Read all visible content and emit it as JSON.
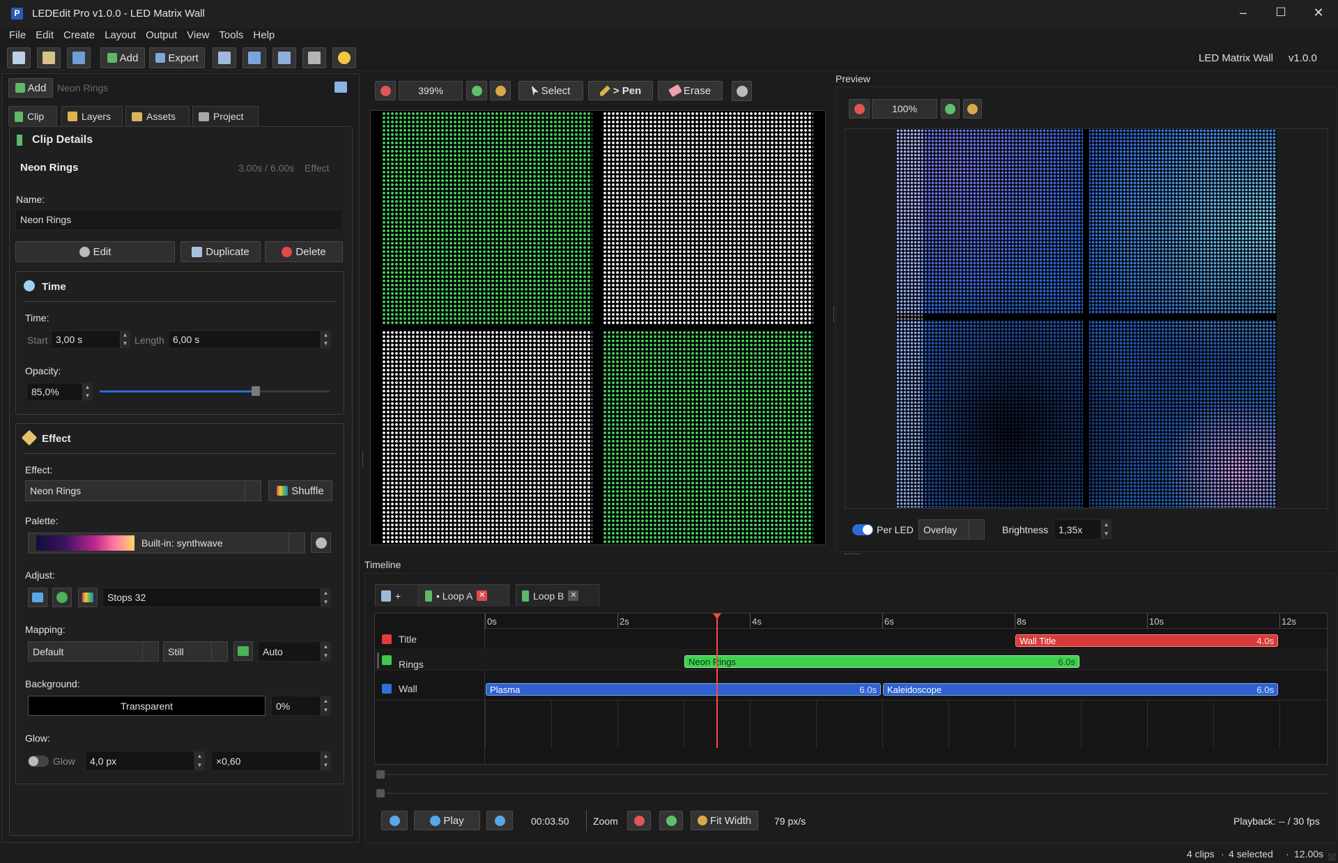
{
  "window": {
    "title": "LEDEdit Pro v1.0.0 - LED Matrix Wall",
    "minimize": "–",
    "maximize": "☐",
    "close": "✕"
  },
  "menu": [
    "File",
    "Edit",
    "Create",
    "Layout",
    "Output",
    "View",
    "Tools",
    "Help"
  ],
  "toolbar": {
    "add_label": "Add",
    "export_label": "Export",
    "project_name": "LED Matrix Wall",
    "version": "v1.0.0"
  },
  "left": {
    "add_label": "Add",
    "search_placeholder": "Neon Rings",
    "tabs": [
      "Clip",
      "Layers",
      "Assets",
      "Project"
    ],
    "clip_details": {
      "header": "Clip Details",
      "clip_name": "Neon Rings",
      "time_info": "3.00s / 6.00s",
      "kind": "Effect",
      "name_label": "Name:",
      "name_value": "Neon Rings",
      "edit_label": "Edit",
      "duplicate_label": "Duplicate",
      "delete_label": "Delete"
    },
    "time": {
      "header": "Time",
      "time_label": "Time:",
      "start_label": "Start",
      "start_value": "3,00 s",
      "length_label": "Length",
      "length_value": "6,00 s",
      "opacity_label": "Opacity:",
      "opacity_value": "85,0%",
      "opacity_fraction": 0.85
    },
    "effect": {
      "header": "Effect",
      "effect_label": "Effect:",
      "effect_value": "Neon Rings",
      "shuffle_label": "Shuffle",
      "palette_label": "Palette:",
      "palette_value": "Built-in: synthwave",
      "adjust_label": "Adjust:",
      "stops_value": "Stops 32",
      "mapping_label": "Mapping:",
      "mapping_value": "Default",
      "mode_value": "Still",
      "auto_value": "Auto",
      "background_label": "Background:",
      "background_value": "Transparent",
      "background_pct": "0%",
      "glow_label": "Glow:",
      "glow_toggle_label": "Glow",
      "glow_px": "4,0 px",
      "glow_mult": "×0,60"
    }
  },
  "editor": {
    "zoom": "399%",
    "select_label": "Select",
    "pen_label": "> Pen",
    "erase_label": "Erase"
  },
  "preview": {
    "title": "Preview",
    "zoom": "100%",
    "per_led_label": "Per LED",
    "blend_value": "Overlay",
    "brightness_label": "Brightness",
    "brightness_value": "1,35x"
  },
  "timeline": {
    "title": "Timeline",
    "add_label": "+",
    "tabs": [
      "• Loop A",
      "Loop B"
    ],
    "ruler": [
      "0s",
      "2s",
      "4s",
      "6s",
      "8s",
      "10s",
      "12s"
    ],
    "tracks": [
      {
        "name": "Title",
        "color": "#e23b3b"
      },
      {
        "name": "Rings",
        "color": "#3ec94d"
      },
      {
        "name": "Wall",
        "color": "#2f6fe0"
      }
    ],
    "clips": [
      {
        "name": "Wall Title",
        "duration": "4.0s",
        "track": 0,
        "start": 8.0,
        "length": 4.0
      },
      {
        "name": "Neon Rings",
        "duration": "6.0s",
        "track": 1,
        "start": 3.0,
        "length": 6.0
      },
      {
        "name": "Plasma",
        "duration": "6.0s",
        "track": 2,
        "start": 0.0,
        "length": 6.0
      },
      {
        "name": "Kaleidoscope",
        "duration": "6.0s",
        "track": 2,
        "start": 6.0,
        "length": 6.0
      }
    ],
    "playhead_s": 3.5,
    "play_label": "Play",
    "timecode": "00:03.50",
    "zoom_label": "Zoom",
    "fit_label": "Fit Width",
    "pps": "79 px/s",
    "playback": "Playback: -- / 30 fps"
  },
  "status": {
    "clips": "4 clips",
    "selected": "4 selected",
    "duration": "12.00s"
  }
}
